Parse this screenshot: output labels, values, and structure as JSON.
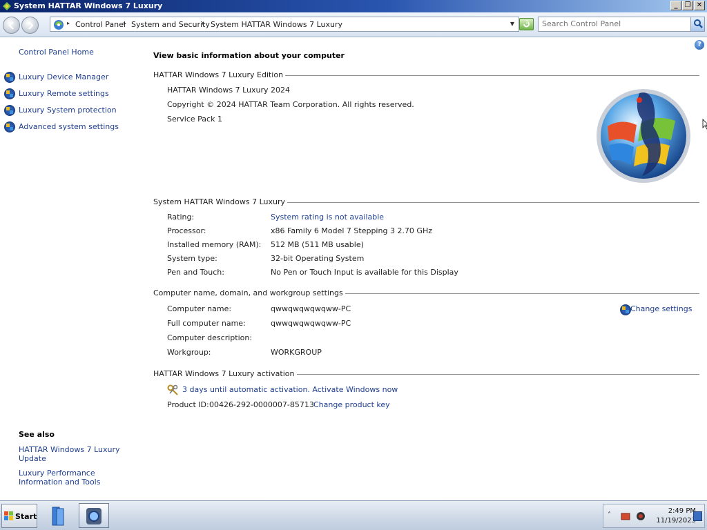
{
  "window": {
    "title": "System HATTAR Windows 7 Luxury",
    "min_label": "_",
    "max_label": "❐",
    "close_label": "✕"
  },
  "address": {
    "crumbs": [
      "Control Panel",
      "System and Security",
      "System HATTAR Windows 7 Luxury"
    ],
    "search_placeholder": "Search Control Panel"
  },
  "sidebar": {
    "home": "Control Panel Home",
    "items": [
      {
        "label": "Luxury Device Manager",
        "icon": "shield-icon"
      },
      {
        "label": "Luxury Remote settings",
        "icon": "shield-icon"
      },
      {
        "label": "Luxury System protection",
        "icon": "shield-icon"
      },
      {
        "label": "Advanced system settings",
        "icon": "shield-icon"
      }
    ],
    "see_also_title": "See also",
    "see_also": [
      {
        "label": "HATTAR Windows 7 Luxury Update"
      },
      {
        "label": "Luxury Performance Information and Tools"
      }
    ]
  },
  "main": {
    "page_title": "View basic information about your computer",
    "edition": {
      "header": "HATTAR Windows 7 Luxury Edition",
      "name": "HATTAR Windows 7 Luxury 2024",
      "copyright": "Copyright © 2024 HATTAR Team Corporation.  All rights reserved.",
      "service_pack": "Service Pack 1"
    },
    "system": {
      "header": "System HATTAR Windows 7 Luxury",
      "rows": [
        {
          "label": "Rating:",
          "value": "System rating is not available"
        },
        {
          "label": "Processor:",
          "value": "x86 Family 6 Model 7 Stepping 3   2.70 GHz"
        },
        {
          "label": "Installed memory (RAM):",
          "value": "512 MB (511 MB usable)"
        },
        {
          "label": "System type:",
          "value": "32-bit Operating System"
        },
        {
          "label": "Pen and Touch:",
          "value": "No Pen or Touch Input is available for this Display"
        }
      ]
    },
    "computer": {
      "header": "Computer name, domain, and workgroup settings",
      "rows": [
        {
          "label": "Computer name:",
          "value": "qwwqwqwqwqww-PC"
        },
        {
          "label": "Full computer name:",
          "value": "qwwqwqwqwqww-PC"
        },
        {
          "label": "Computer description:",
          "value": ""
        },
        {
          "label": "Workgroup:",
          "value": "WORKGROUP"
        }
      ],
      "change_settings": "Change settings"
    },
    "activation": {
      "header": "HATTAR Windows 7 Luxury activation",
      "status": "3 days until automatic activation. Activate Windows now",
      "product_id_label": "Product ID:",
      "product_id": "00426-292-0000007-85713",
      "change_key": "Change product key"
    }
  },
  "taskbar": {
    "start_label": "Start",
    "time": "2:49 PM",
    "date": "11/19/2023",
    "tray_arrow": "˄"
  },
  "colors": {
    "link": "#1e3d8f",
    "title_bar": "#0a246a"
  }
}
